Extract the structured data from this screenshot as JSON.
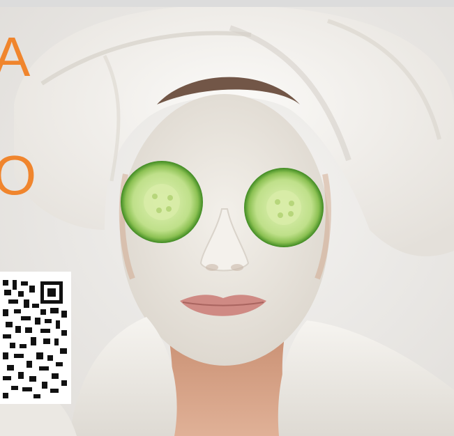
{
  "promo": {
    "line1": "A",
    "line2": "O"
  },
  "photo": {
    "subject": "woman-with-facial-mask-and-cucumber-slices-icon"
  },
  "qr_code": {
    "icon": "qr-code-icon"
  },
  "colors": {
    "accent": "#f0852d",
    "towel": "#f4f2ef",
    "mask": "#ece8e1",
    "skin": "#d9a589",
    "cucumber_rind": "#4f9a2c",
    "cucumber_flesh": "#c9e69a",
    "lips": "#cf8a84"
  }
}
